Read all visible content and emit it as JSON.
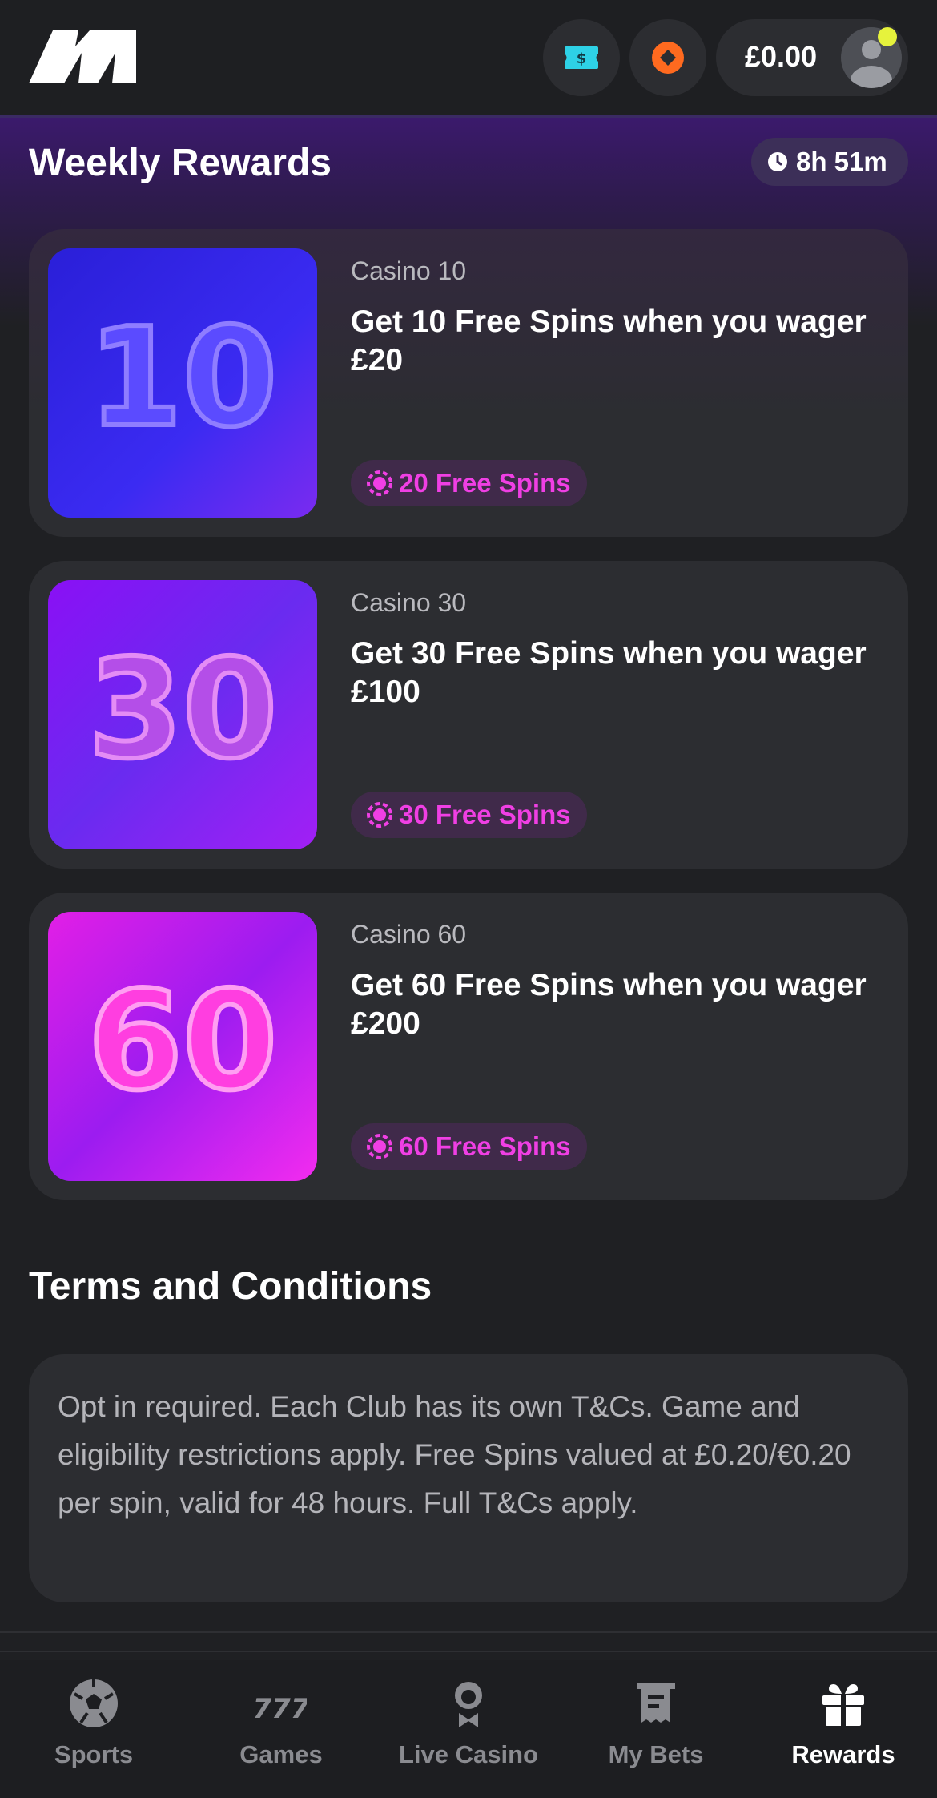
{
  "header": {
    "logo_icon": "brand-logo-m",
    "cash_icon": "cash-ticket-icon",
    "gem_icon": "orange-gem-icon",
    "balance": "£0.00",
    "avatar_icon": "user-avatar-icon",
    "notification_color": "#e6f23c"
  },
  "page": {
    "title": "Weekly Rewards",
    "timer": "8h 51m",
    "timer_icon": "clock-icon"
  },
  "rewards": [
    {
      "category": "Casino 10",
      "title": "Get 10 Free Spins when you wager £20",
      "badge": "20 Free Spins",
      "image_number": "10"
    },
    {
      "category": "Casino 30",
      "title": "Get 30 Free Spins when you wager £100",
      "badge": "30 Free Spins",
      "image_number": "30"
    },
    {
      "category": "Casino 60",
      "title": "Get 60 Free Spins when you wager £200",
      "badge": "60 Free Spins",
      "image_number": "60"
    }
  ],
  "terms": {
    "title": "Terms and Conditions",
    "text": "Opt in required. Each Club has its own T&Cs. Game and eligibility restrictions apply. Free Spins valued at £0.20/€0.20 per spin, valid for 48 hours. Full T&Cs apply."
  },
  "nav": {
    "items": [
      {
        "label": "Sports",
        "icon": "soccer-ball-icon"
      },
      {
        "label": "Games",
        "icon": "slots-777-icon"
      },
      {
        "label": "Live Casino",
        "icon": "dealer-icon"
      },
      {
        "label": "My Bets",
        "icon": "bet-slip-icon"
      },
      {
        "label": "Rewards",
        "icon": "gift-icon"
      }
    ],
    "active": "Rewards"
  },
  "colors": {
    "accent_pink": "#f03fe4",
    "band_purple": "#3b1a6c",
    "card_bg": "#2c2d31",
    "page_bg": "#1f2023"
  }
}
